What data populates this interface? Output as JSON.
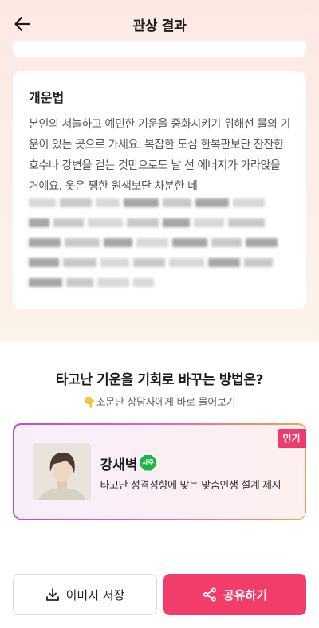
{
  "header": {
    "title": "관상 결과",
    "back_icon": "arrow-left-icon"
  },
  "fortune": {
    "title": "개운법",
    "body": "본인의 서늘하고 예민한 기운을 중화시키기 위해선 물의 기운이 있는 곳으로 가세요. 복잡한 도심 한복판보단 잔잔한 호수나 강변을 걷는 것만으로도 날 선 에너지가 가라앉을 거예요. 옷은 쨍한 원색보단 차분한 네"
  },
  "promo": {
    "title": "타고난 기운을 기회로 바꾸는 방법은?",
    "subtitle": "👇소문난 상담사에게 바로 물어보기",
    "card": {
      "badge": "인기",
      "name": "강새벽",
      "category_badge": "사주",
      "description": "타고난 성격성향에 맞는 맞춤인생 설계 제시"
    }
  },
  "actions": {
    "save_label": "이미지 저장",
    "share_label": "공유하기"
  },
  "colors": {
    "accent": "#f23d6b",
    "badge_green": "#1eb547"
  }
}
